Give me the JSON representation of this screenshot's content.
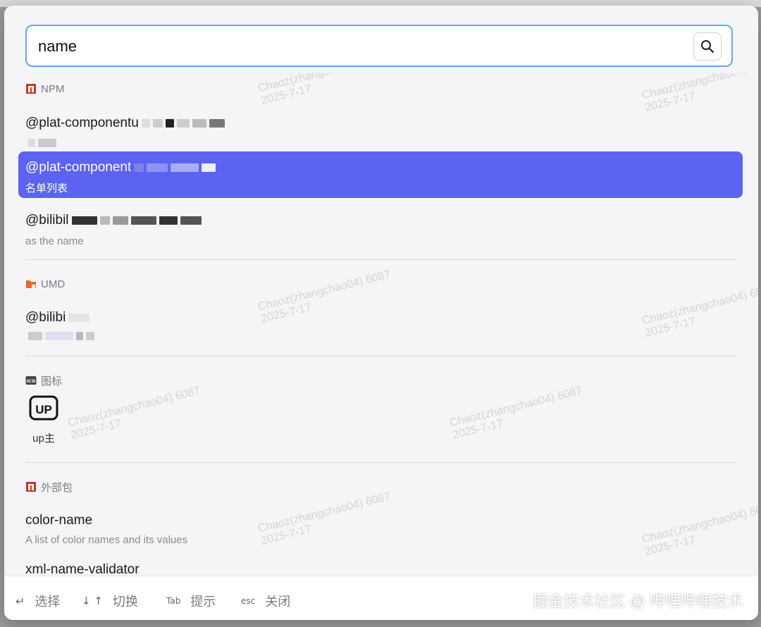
{
  "search": {
    "value": "name"
  },
  "groups": [
    {
      "title": "NPM",
      "icon": "npm-icon",
      "color": "#c9352b",
      "items": [
        {
          "title": "@plat-componentu",
          "desc": ""
        },
        {
          "title": "@plat-component",
          "desc": "名单列表",
          "selected": true
        },
        {
          "title": "@bilibil",
          "desc": "as the name"
        }
      ]
    },
    {
      "title": "UMD",
      "icon": "folder-icon",
      "color": "#e86a2c",
      "items": [
        {
          "title": "@bilibi",
          "desc": ""
        }
      ]
    },
    {
      "title": "图标",
      "icon": "ico-icon",
      "items": [
        {
          "glyph": "UP",
          "label": "up主"
        }
      ]
    },
    {
      "title": "外部包",
      "icon": "npm-icon",
      "color": "#c9352b",
      "items": [
        {
          "title": "color-name",
          "desc": "A list of color names and its values"
        },
        {
          "title": "xml-name-validator",
          "desc": ""
        }
      ]
    }
  ],
  "footer": {
    "hints": [
      {
        "key": "↵",
        "label": "选择"
      },
      {
        "key": "↓ ↑",
        "label": "切换"
      },
      {
        "key": "Tab",
        "label": "提示"
      },
      {
        "key": "esc",
        "label": "关闭"
      }
    ],
    "brand": "掘金技术社区 @ 哔哩哔哩技术"
  },
  "watermark": {
    "text": "Chaoz(zhangchao04) 6087",
    "date": "2025-7-17"
  },
  "colors": {
    "accent": "#5b63f0",
    "search_border": "#6aa6e8"
  }
}
